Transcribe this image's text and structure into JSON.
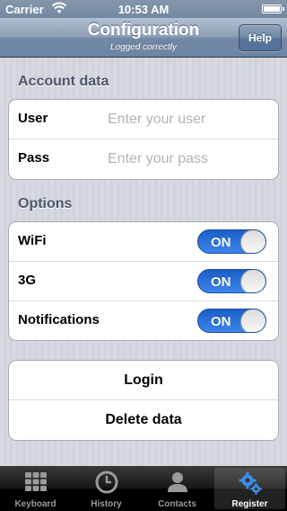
{
  "status_bar": {
    "carrier": "Carrier",
    "time": "10:53 AM"
  },
  "nav": {
    "title": "Configuration",
    "subtitle": "Logged correctly",
    "help_label": "Help"
  },
  "account": {
    "header": "Account data",
    "user_label": "User",
    "user_placeholder": "Enter your user",
    "user_value": "",
    "pass_label": "Pass",
    "pass_placeholder": "Enter your pass",
    "pass_value": ""
  },
  "options": {
    "header": "Options",
    "items": [
      {
        "label": "WiFi",
        "state": "ON"
      },
      {
        "label": "3G",
        "state": "ON"
      },
      {
        "label": "Notifications",
        "state": "ON"
      }
    ]
  },
  "actions": {
    "login_label": "Login",
    "delete_label": "Delete data"
  },
  "tabbar": {
    "tabs": [
      {
        "label": "Keyboard",
        "icon": "keypad-icon"
      },
      {
        "label": "History",
        "icon": "clock-icon"
      },
      {
        "label": "Contacts",
        "icon": "person-icon"
      },
      {
        "label": "Register",
        "icon": "gears-icon"
      }
    ],
    "selected": "Register"
  },
  "colors": {
    "switch_on": "#2e74de",
    "tab_active_icon": "#3b8de8"
  }
}
